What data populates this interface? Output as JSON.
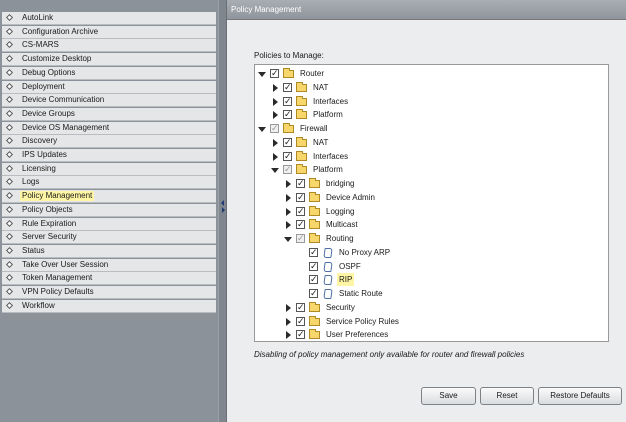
{
  "sidebar": {
    "items": [
      {
        "label": "AutoLink"
      },
      {
        "label": "Configuration Archive"
      },
      {
        "label": "CS-MARS"
      },
      {
        "label": "Customize Desktop"
      },
      {
        "label": "Debug Options"
      },
      {
        "label": "Deployment"
      },
      {
        "label": "Device Communication"
      },
      {
        "label": "Device Groups"
      },
      {
        "label": "Device OS Management"
      },
      {
        "label": "Discovery"
      },
      {
        "label": "IPS Updates"
      },
      {
        "label": "Licensing"
      },
      {
        "label": "Logs"
      },
      {
        "label": "Policy Management",
        "selected": true
      },
      {
        "label": "Policy Objects"
      },
      {
        "label": "Rule Expiration"
      },
      {
        "label": "Server Security"
      },
      {
        "label": "Status"
      },
      {
        "label": "Take Over User Session"
      },
      {
        "label": "Token Management"
      },
      {
        "label": "VPN Policy Defaults"
      },
      {
        "label": "Workflow"
      }
    ]
  },
  "main": {
    "title": "Policy Management",
    "policies_label": "Policies to Manage:",
    "tree": [
      {
        "label": "Router",
        "level": 0,
        "expander": "open",
        "check": "checked",
        "icon": "folder"
      },
      {
        "label": "NAT",
        "level": 1,
        "expander": "closed",
        "check": "checked",
        "icon": "folder"
      },
      {
        "label": "Interfaces",
        "level": 1,
        "expander": "closed",
        "check": "checked",
        "icon": "folder"
      },
      {
        "label": "Platform",
        "level": 1,
        "expander": "closed",
        "check": "checked",
        "icon": "folder"
      },
      {
        "label": "Firewall",
        "level": 0,
        "expander": "open",
        "check": "partial",
        "icon": "folder"
      },
      {
        "label": "NAT",
        "level": 1,
        "expander": "closed",
        "check": "checked",
        "icon": "folder"
      },
      {
        "label": "Interfaces",
        "level": 1,
        "expander": "closed",
        "check": "checked",
        "icon": "folder"
      },
      {
        "label": "Platform",
        "level": 1,
        "expander": "open",
        "check": "partial",
        "icon": "folder"
      },
      {
        "label": "bridging",
        "level": 2,
        "expander": "closed",
        "check": "checked",
        "icon": "folder"
      },
      {
        "label": "Device Admin",
        "level": 2,
        "expander": "closed",
        "check": "checked",
        "icon": "folder"
      },
      {
        "label": "Logging",
        "level": 2,
        "expander": "closed",
        "check": "checked",
        "icon": "folder"
      },
      {
        "label": "Multicast",
        "level": 2,
        "expander": "closed",
        "check": "checked",
        "icon": "folder"
      },
      {
        "label": "Routing",
        "level": 2,
        "expander": "open",
        "check": "partial",
        "icon": "folder"
      },
      {
        "label": "No Proxy ARP",
        "level": 3,
        "expander": "none",
        "check": "checked",
        "icon": "doc"
      },
      {
        "label": "OSPF",
        "level": 3,
        "expander": "none",
        "check": "checked",
        "icon": "doc"
      },
      {
        "label": "RIP",
        "level": 3,
        "expander": "none",
        "check": "checked",
        "icon": "doc",
        "highlight": true
      },
      {
        "label": "Static Route",
        "level": 3,
        "expander": "none",
        "check": "checked",
        "icon": "doc"
      },
      {
        "label": "Security",
        "level": 2,
        "expander": "closed",
        "check": "checked",
        "icon": "folder"
      },
      {
        "label": "Service Policy Rules",
        "level": 2,
        "expander": "closed",
        "check": "checked",
        "icon": "folder"
      },
      {
        "label": "User Preferences",
        "level": 2,
        "expander": "closed",
        "check": "checked",
        "icon": "folder"
      }
    ],
    "note": "Disabling of policy management only available for router and firewall policies",
    "buttons": {
      "save": "Save",
      "reset": "Reset",
      "restore": "Restore Defaults"
    }
  },
  "colors": {
    "selection_highlight": "#fff6a5",
    "header": "#8f959c",
    "sidebar_bg": "#e4e6e8"
  }
}
